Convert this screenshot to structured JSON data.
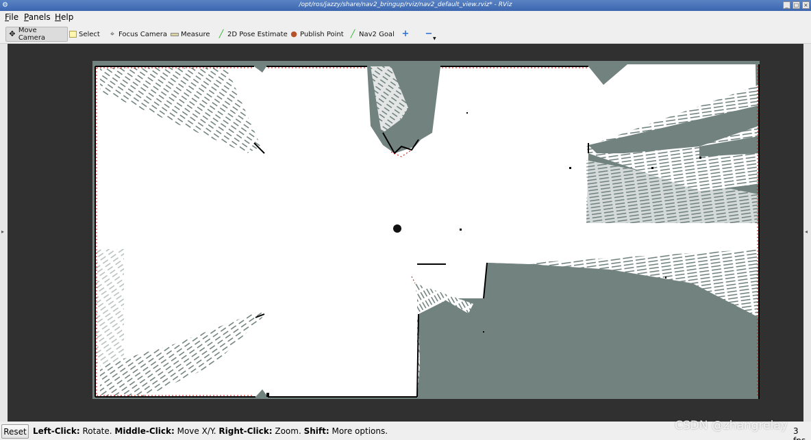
{
  "window": {
    "title": "/opt/ros/jazzy/share/nav2_bringup/rviz/nav2_default_view.rviz* - RViz"
  },
  "menu": {
    "items": [
      {
        "label": "File",
        "mnemonic": "F",
        "rest": "ile"
      },
      {
        "label": "Panels",
        "mnemonic": "P",
        "rest": "anels"
      },
      {
        "label": "Help",
        "mnemonic": "H",
        "rest": "elp"
      }
    ]
  },
  "toolbar": {
    "tools": [
      {
        "label": "Move Camera",
        "icon": "move-camera-icon",
        "active": true
      },
      {
        "label": "Select",
        "icon": "select-icon",
        "active": false
      },
      {
        "label": "Focus Camera",
        "icon": "focus-camera-icon",
        "active": false
      },
      {
        "label": "Measure",
        "icon": "measure-icon",
        "active": false
      },
      {
        "label": "2D Pose Estimate",
        "icon": "pose-estimate-icon",
        "active": false
      },
      {
        "label": "Publish Point",
        "icon": "publish-point-icon",
        "active": false
      },
      {
        "label": "Nav2 Goal",
        "icon": "nav2-goal-icon",
        "active": false
      }
    ],
    "add_tool_icon": "plus-icon",
    "remove_tool_icon": "minus-icon"
  },
  "status": {
    "reset_label": "Reset",
    "hint": [
      {
        "key": "Left-Click:",
        "text": " Rotate. "
      },
      {
        "key": "Middle-Click:",
        "text": " Move X/Y. "
      },
      {
        "key": "Right-Click:",
        "text": " Zoom. "
      },
      {
        "key": "Shift:",
        "text": " More options."
      }
    ],
    "fps": "3 fps"
  },
  "watermark": "CSDN @zhangrelay",
  "colors": {
    "viewport_bg": "#303030",
    "map_unknown": "#71827f",
    "map_free": "#ffffff",
    "map_wall": "#000000",
    "map_costmap_edge": "#e00000",
    "robot": "#111111"
  }
}
